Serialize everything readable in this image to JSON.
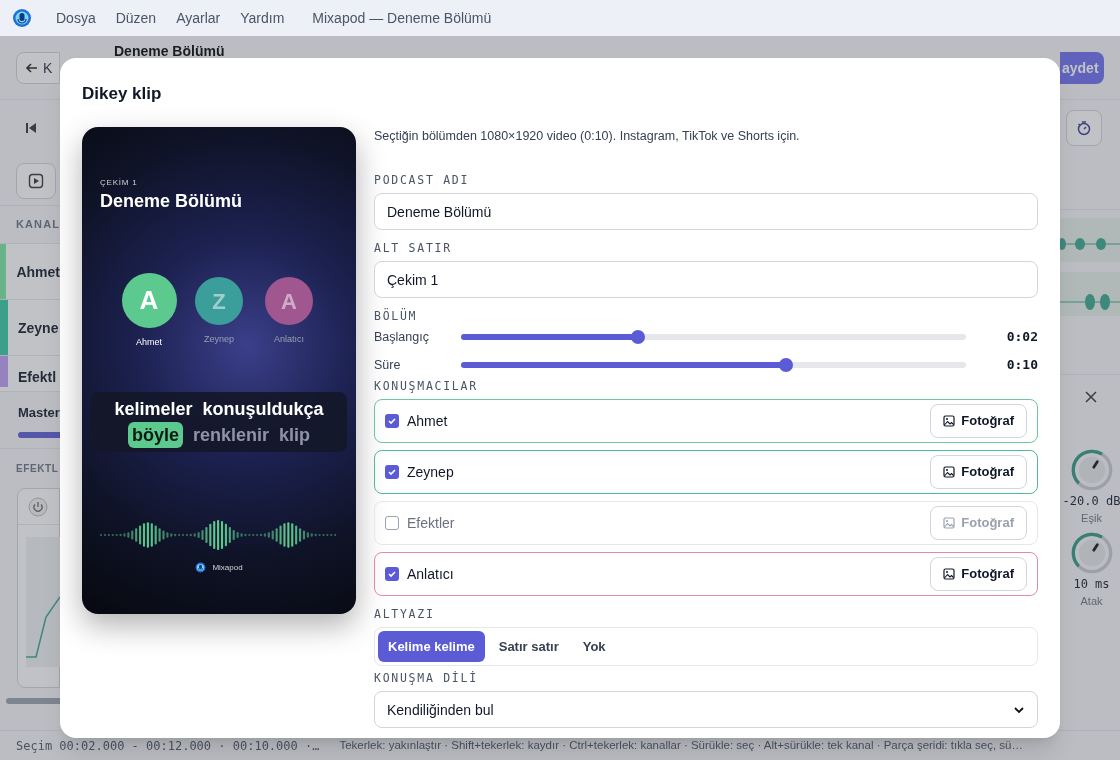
{
  "menu_bar": {
    "items": [
      "Dosya",
      "Düzen",
      "Ayarlar",
      "Yardım"
    ],
    "title": "Mixapod — Deneme Bölümü"
  },
  "background": {
    "back_button": "K",
    "episode_title": "Deneme Bölümü",
    "save_button": "aydet",
    "channels_label": "KANAL",
    "channels": [
      {
        "name": "Ahmet",
        "color": "#68b488"
      },
      {
        "name": "Zeyne",
        "color": "#3d9e8a"
      },
      {
        "name": "Efektl",
        "color": "#9882c0"
      }
    ],
    "master_label": "Master",
    "effects_label": "EFEKTL",
    "knobs": [
      {
        "reading": "-20.0 dB",
        "label": "Eşik",
        "level": 0.62
      },
      {
        "reading": "10 ms",
        "label": "Atak",
        "level": 0.62
      }
    ]
  },
  "dialog": {
    "title": "Dikey klip",
    "preview": {
      "kicker": "ÇEKİM 1",
      "title": "Deneme Bölümü",
      "speakers": [
        {
          "initial": "A",
          "name": "Ahmet",
          "active": true,
          "color": "#5cc98f"
        },
        {
          "initial": "Z",
          "name": "Zeynep",
          "active": false,
          "color": "#3b9e9a"
        },
        {
          "initial": "A",
          "name": "Anlatıcı",
          "active": false,
          "color": "#a0568f"
        }
      ],
      "caption_lines": [
        [
          {
            "word": "kelimeler",
            "spoken": true,
            "highlighted": false
          },
          {
            "word": "konuşuldukça",
            "spoken": true,
            "highlighted": false
          }
        ],
        [
          {
            "word": "böyle",
            "spoken": true,
            "highlighted": true
          },
          {
            "word": "renklenir",
            "spoken": false,
            "highlighted": false
          },
          {
            "word": "klip",
            "spoken": false,
            "highlighted": false
          }
        ]
      ],
      "brand": "Mixapod"
    },
    "description": "Seçtiğin bölümden 1080×1920 video (0:10). Instagram, TikTok ve Shorts için.",
    "podcast_name": {
      "label": "PODCAST ADI",
      "value": "Deneme Bölümü"
    },
    "subtitle_line": {
      "label": "ALT SATIR",
      "value": "Çekim 1"
    },
    "section": {
      "label": "BÖLÜM",
      "sliders": [
        {
          "name": "Başlangıç",
          "level": 0.35,
          "reading": "0:02"
        },
        {
          "name": "Süre",
          "level": 0.643,
          "reading": "0:10"
        }
      ]
    },
    "speakers": {
      "label": "KONUŞMACILAR",
      "items": [
        {
          "name": "Ahmet",
          "checked": true,
          "color": "#6cc79a",
          "button": "Fotoğraf"
        },
        {
          "name": "Zeynep",
          "checked": true,
          "color": "#4dbb9c",
          "button": "Fotoğraf"
        },
        {
          "name": "Efektler",
          "checked": false,
          "button": "Fotoğraf"
        },
        {
          "name": "Anlatıcı",
          "checked": true,
          "color": "#e08aa8",
          "button": "Fotoğraf"
        }
      ]
    },
    "captions": {
      "label": "ALTYAZI",
      "options": [
        {
          "label": "Kelime kelime",
          "selected": true
        },
        {
          "label": "Satır satır",
          "selected": false
        },
        {
          "label": "Yok",
          "selected": false
        }
      ]
    },
    "language": {
      "label": "KONUŞMA DİLİ",
      "value": "Kendiliğinden bul"
    }
  },
  "status_bar": {
    "selection": "Seçim 00:02.000 - 00:12.000 · 00:10.000 ·…",
    "hints": "Tekerlek: yakınlaştır · Shift+tekerlek: kaydır · Ctrl+tekerlek: kanallar · Sürükle: seç · Alt+sürükle: tek kanal · Parça şeridi: tıkla seç, sü…"
  }
}
